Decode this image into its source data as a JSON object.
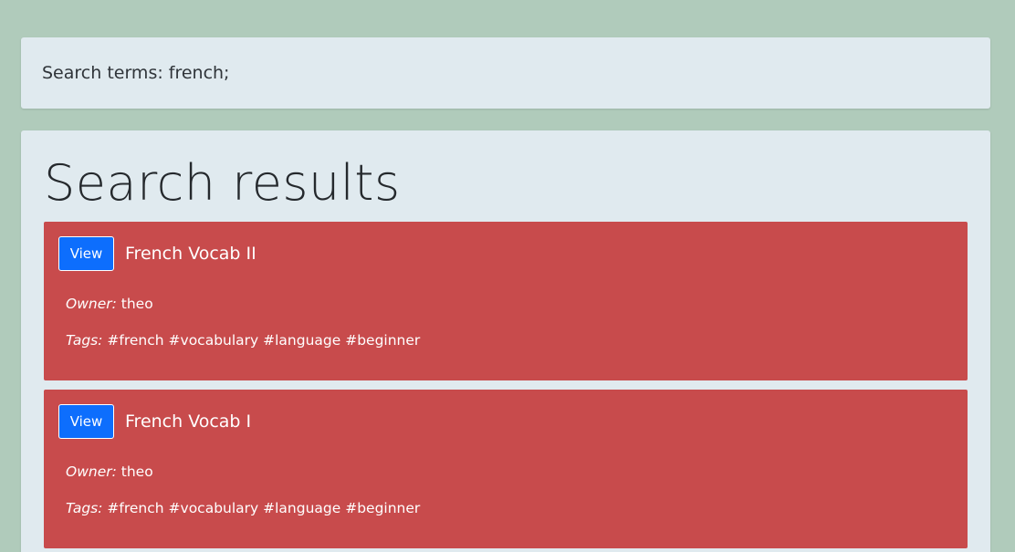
{
  "search": {
    "label": "Search terms:",
    "terms": "french;"
  },
  "results": {
    "title": "Search results",
    "items": [
      {
        "button_label": "View",
        "name": "French Vocab II",
        "owner_label": "Owner:",
        "owner": "theo",
        "tags_label": "Tags:",
        "tags": "#french #vocabulary #language #beginner"
      },
      {
        "button_label": "View",
        "name": "French Vocab I",
        "owner_label": "Owner:",
        "owner": "theo",
        "tags_label": "Tags:",
        "tags": "#french #vocabulary #language #beginner"
      }
    ]
  },
  "colors": {
    "page_background": "#b0cbbb",
    "card_background": "#e0eaef",
    "result_background": "#c84b4c",
    "button_background": "#0d6efd"
  }
}
